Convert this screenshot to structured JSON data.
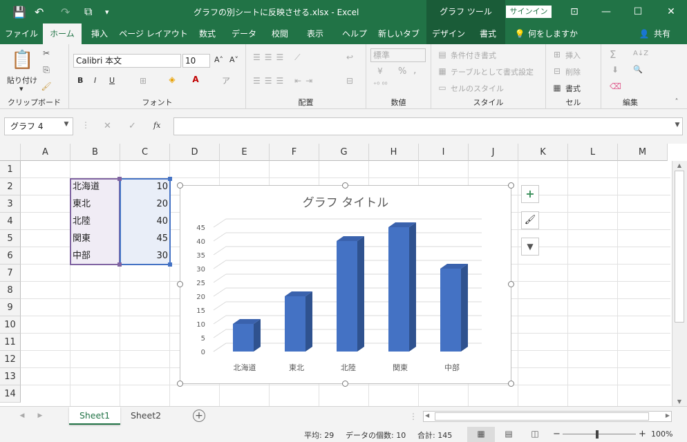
{
  "titlebar": {
    "title": "グラフの別シートに反映させる.xlsx  -  Excel",
    "context_tools": "グラフ ツール",
    "signin": "サインイン",
    "qat": {
      "save": "💾",
      "undo": "↶",
      "redo": "↷",
      "touch": "⧉",
      "more": "▾"
    },
    "controls": {
      "ribbon_opts": "⊡",
      "minimize": "—",
      "maximize": "☐",
      "close": "✕"
    }
  },
  "tabs": [
    "ファイル",
    "ホーム",
    "挿入",
    "ページ レイアウト",
    "数式",
    "データ",
    "校閲",
    "表示",
    "ヘルプ",
    "新しいタブ",
    "デザイン",
    "書式"
  ],
  "tell_me": "何をしますか",
  "share": "共有",
  "ribbon": {
    "clipboard": {
      "label": "クリップボード",
      "paste": "貼り付け",
      "paste_dd": "▾"
    },
    "font": {
      "label": "フォント",
      "name": "Calibri 本文",
      "size": "10",
      "grow": "A˄",
      "shrink": "A˅",
      "bold": "B",
      "italic": "I",
      "underline": "U"
    },
    "alignment": {
      "label": "配置"
    },
    "number": {
      "label": "数値",
      "format": "標準",
      "percent": "%",
      "comma": ","
    },
    "styles": {
      "label": "スタイル",
      "conditional": "条件付き書式",
      "table": "テーブルとして書式設定",
      "cell_styles": "セルのスタイル"
    },
    "cells": {
      "label": "セル",
      "insert": "挿入",
      "delete": "削除",
      "format": "書式"
    },
    "editing": {
      "label": "編集",
      "sum": "Σ",
      "sort": "A↓Z",
      "find": "🔍"
    }
  },
  "formula_bar": {
    "namebox": "グラフ 4",
    "cancel": "✕",
    "enter": "✓",
    "fx": "fx",
    "value": ""
  },
  "columns": [
    "A",
    "B",
    "C",
    "D",
    "E",
    "F",
    "G",
    "H",
    "I",
    "J",
    "K",
    "L",
    "M"
  ],
  "rows": [
    "1",
    "2",
    "3",
    "4",
    "5",
    "6",
    "7",
    "8",
    "9",
    "10",
    "11",
    "12",
    "13",
    "14"
  ],
  "cells": [
    {
      "ref": "B2",
      "text": "北海道"
    },
    {
      "ref": "C2",
      "text": "10"
    },
    {
      "ref": "B3",
      "text": "東北"
    },
    {
      "ref": "C3",
      "text": "20"
    },
    {
      "ref": "B4",
      "text": "北陸"
    },
    {
      "ref": "C4",
      "text": "40"
    },
    {
      "ref": "B5",
      "text": "関東"
    },
    {
      "ref": "C5",
      "text": "45"
    },
    {
      "ref": "B6",
      "text": "中部"
    },
    {
      "ref": "C6",
      "text": "30"
    }
  ],
  "chart_data": {
    "type": "bar",
    "title": "グラフ タイトル",
    "categories": [
      "北海道",
      "東北",
      "北陸",
      "関東",
      "中部"
    ],
    "values": [
      10,
      20,
      40,
      45,
      30
    ],
    "yticks": [
      "0",
      "5",
      "10",
      "15",
      "20",
      "25",
      "30",
      "35",
      "40",
      "45"
    ],
    "ylim": [
      0,
      45
    ],
    "style": "3d-column",
    "bar_color": "#4472C4",
    "grid": true,
    "legend": "none"
  },
  "chart_buttons": {
    "elements": "+",
    "styles": "🖌",
    "filter": "▼"
  },
  "sheets": [
    "Sheet1",
    "Sheet2"
  ],
  "active_sheet": "Sheet1",
  "add_sheet": "+",
  "status": {
    "average": "平均: 29",
    "count": "データの個数: 10",
    "sum": "合計: 145",
    "zoom": "100%",
    "zoom_minus": "−",
    "zoom_plus": "+"
  },
  "colors": {
    "excel_green": "#217346",
    "context_green": "#1a5c38",
    "bar": "#4472C4"
  }
}
